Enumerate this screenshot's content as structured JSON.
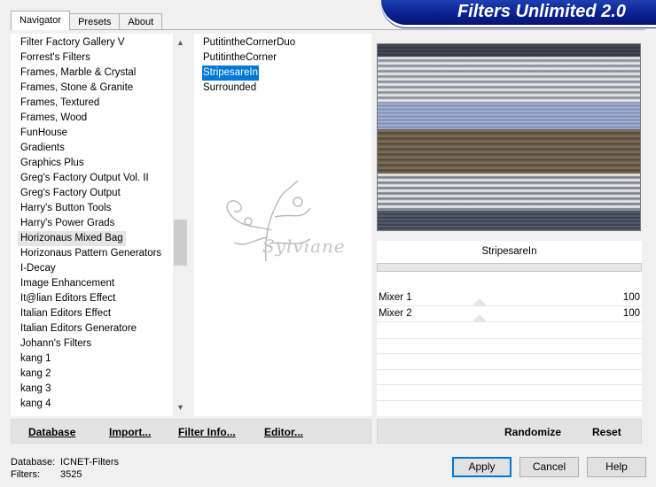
{
  "tabs": [
    "Navigator",
    "Presets",
    "About"
  ],
  "banner_title": "Filters Unlimited 2.0",
  "categories": [
    "Filter Factory Gallery V",
    "Forrest's Filters",
    "Frames, Marble & Crystal",
    "Frames, Stone & Granite",
    "Frames, Textured",
    "Frames, Wood",
    "FunHouse",
    "Gradients",
    "Graphics Plus",
    "Greg's Factory Output Vol. II",
    "Greg's Factory Output",
    "Harry's Button Tools",
    "Harry's Power Grads",
    "Horizonaus Mixed Bag",
    "Horizonaus Pattern Generators",
    "I-Decay",
    "Image Enhancement",
    "It@lian Editors Effect",
    "Italian Editors Effect",
    "Italian Editors Generatore",
    "Johann's Filters",
    "kang 1",
    "kang 2",
    "kang 3",
    "kang 4"
  ],
  "selected_category": "Horizonaus Mixed Bag",
  "filters": [
    "PutitintheCornerDuo",
    "PutitintheCorner",
    "StripesareIn",
    "Surrounded"
  ],
  "selected_filter": "StripesareIn",
  "watermark_text": "Sylviane",
  "filter_name": "StripesareIn",
  "controls": [
    {
      "label": "Mixer 1",
      "value": "100"
    },
    {
      "label": "Mixer 2",
      "value": "100"
    }
  ],
  "left_buttons": [
    "Database",
    "Import...",
    "Filter Info...",
    "Editor..."
  ],
  "right_buttons": [
    "Randomize",
    "Reset"
  ],
  "status": {
    "database_label": "Database:",
    "database_value": "ICNET-Filters",
    "filters_label": "Filters:",
    "filters_value": "3525"
  },
  "dialog_buttons": [
    "Apply",
    "Cancel",
    "Help"
  ]
}
